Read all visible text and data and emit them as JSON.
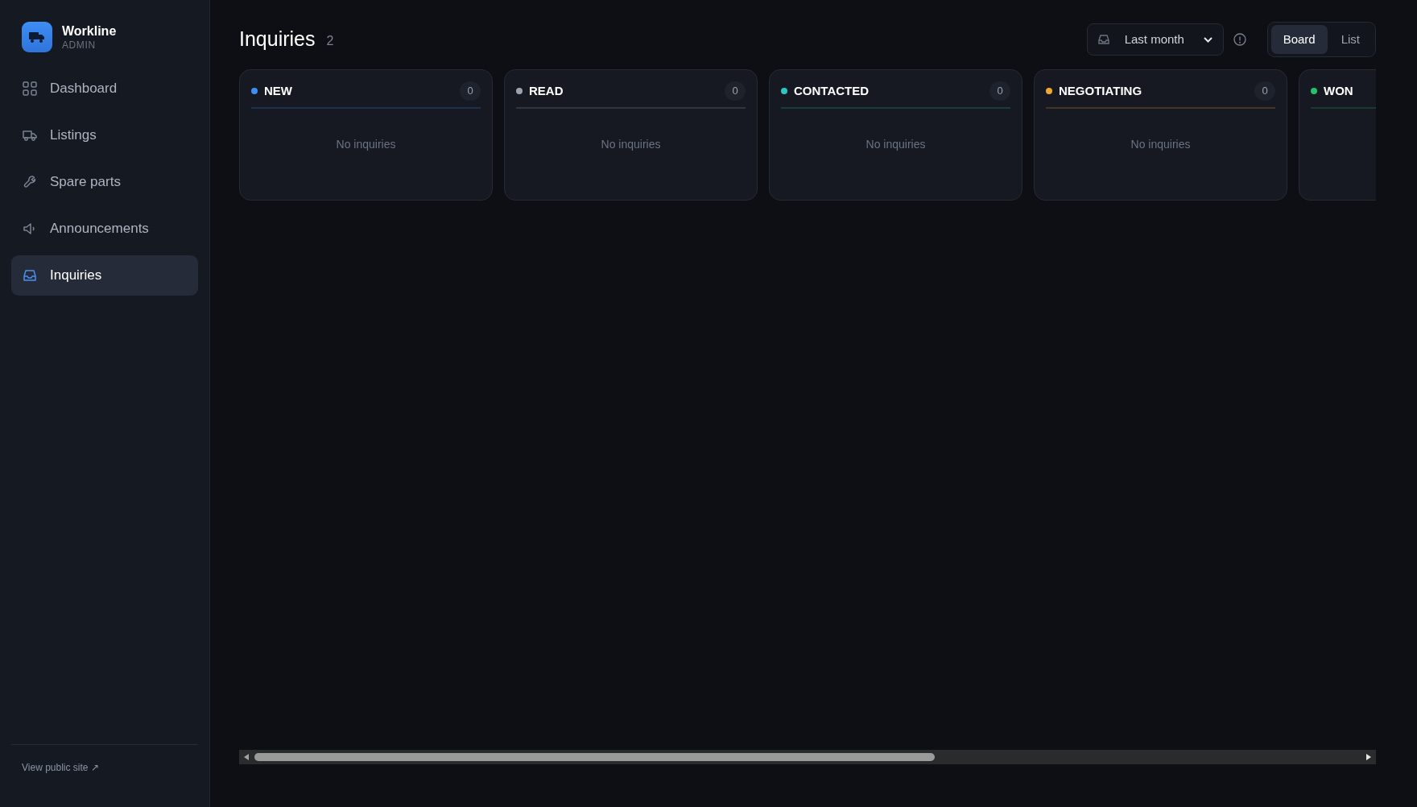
{
  "brand": {
    "name": "Workline",
    "subtitle": "ADMIN"
  },
  "sidebar": {
    "items": [
      {
        "label": "Dashboard",
        "selected": false
      },
      {
        "label": "Listings",
        "selected": false
      },
      {
        "label": "Spare parts",
        "selected": false
      },
      {
        "label": "Announcements",
        "selected": false
      },
      {
        "label": "Inquiries",
        "selected": true
      }
    ],
    "footer_link": "View public site ↗"
  },
  "header": {
    "title": "Inquiries",
    "count": "2",
    "period": {
      "value": "Last month"
    },
    "views": [
      {
        "label": "Board",
        "selected": true
      },
      {
        "label": "List",
        "selected": false
      }
    ]
  },
  "board": {
    "columns": [
      {
        "title": "NEW",
        "color": "#3b8ff6",
        "count": "0",
        "empty_text": "No inquiries"
      },
      {
        "title": "READ",
        "color": "#9ca3af",
        "count": "0",
        "empty_text": "No inquiries"
      },
      {
        "title": "CONTACTED",
        "color": "#2ec4c4",
        "count": "0",
        "empty_text": "No inquiries"
      },
      {
        "title": "NEGOTIATING",
        "color": "#f0a92e",
        "count": "0",
        "empty_text": "No inquiries"
      },
      {
        "title": "WON",
        "color": "#22c36b"
      }
    ]
  }
}
